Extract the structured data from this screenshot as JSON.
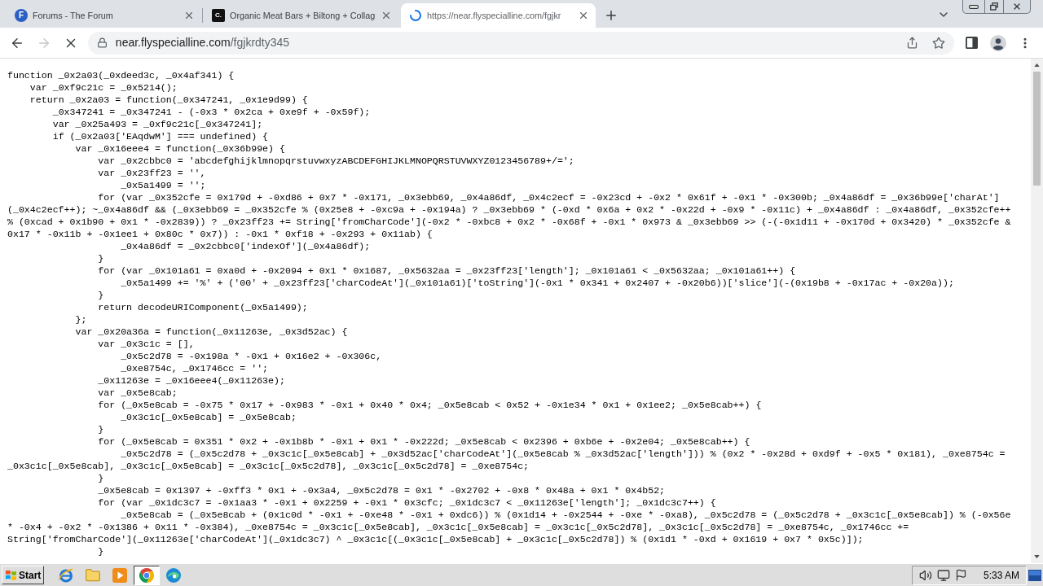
{
  "tabs": [
    {
      "badge": "F",
      "title": "Forums - The Forum",
      "selected": false,
      "loading": false
    },
    {
      "badge": "C.",
      "title": "Organic Meat Bars + Biltong + Collag",
      "selected": false,
      "loading": false
    },
    {
      "title": "https://near.flyspecialline.com/fgjkr",
      "selected": true,
      "loading": true
    }
  ],
  "toolbar": {
    "back": {
      "disabled": false
    },
    "forward": {
      "disabled": true
    },
    "loading": true
  },
  "address_bar": {
    "host": "near.flyspecialline.com",
    "path": "/fgjkrdty345"
  },
  "page": {
    "lines": [
      "function _0x2a03(_0xdeed3c, _0x4af341) {",
      "    var _0xf9c21c = _0x5214();",
      "    return _0x2a03 = function(_0x347241, _0x1e9d99) {",
      "        _0x347241 = _0x347241 - (-0x3 * 0x2ca + 0xe9f + -0x59f);",
      "        var _0x25a493 = _0xf9c21c[_0x347241];",
      "        if (_0x2a03['EAqdwM'] === undefined) {",
      "            var _0x16eee4 = function(_0x36b99e) {",
      "                var _0x2cbbc0 = 'abcdefghijklmnopqrstuvwxyzABCDEFGHIJKLMNOPQRSTUVWXYZ0123456789+/=';",
      "                var _0x23ff23 = '',",
      "                    _0x5a1499 = '';",
      "                for (var _0x352cfe = 0x179d + -0xd86 + 0x7 * -0x171, _0x3ebb69, _0x4a86df, _0x4c2ecf = -0x23cd + -0x2 * 0x61f + -0x1 * -0x300b; _0x4a86df = _0x36b99e['charAt']",
      "(_0x4c2ecf++); ~_0x4a86df && (_0x3ebb69 = _0x352cfe % (0x25e8 + -0xc9a + -0x194a) ? _0x3ebb69 * (-0xd * 0x6a + 0x2 * -0x22d + -0x9 * -0x11c) + _0x4a86df : _0x4a86df, _0x352cfe++",
      "% (0xcad + 0x1b90 + 0x1 * -0x2839)) ? _0x23ff23 += String['fromCharCode'](-0x2 * -0xbc8 + 0x2 * -0x68f + -0x1 * 0x973 & _0x3ebb69 >> (-(-0x1d11 + -0x170d + 0x3420) * _0x352cfe &",
      "0x17 * -0x11b + -0x1ee1 + 0x80c * 0x7)) : -0x1 * 0xf18 + -0x293 + 0x11ab) {",
      "                    _0x4a86df = _0x2cbbc0['indexOf'](_0x4a86df);",
      "                }",
      "                for (var _0x101a61 = 0xa0d + -0x2094 + 0x1 * 0x1687, _0x5632aa = _0x23ff23['length']; _0x101a61 < _0x5632aa; _0x101a61++) {",
      "                    _0x5a1499 += '%' + ('00' + _0x23ff23['charCodeAt'](_0x101a61)['toString'](-0x1 * 0x341 + 0x2407 + -0x20b6))['slice'](-(0x19b8 + -0x17ac + -0x20a));",
      "                }",
      "                return decodeURIComponent(_0x5a1499);",
      "            };",
      "            var _0x20a36a = function(_0x11263e, _0x3d52ac) {",
      "                var _0x3c1c = [],",
      "                    _0x5c2d78 = -0x198a * -0x1 + 0x16e2 + -0x306c,",
      "                    _0xe8754c, _0x1746cc = '';",
      "                _0x11263e = _0x16eee4(_0x11263e);",
      "                var _0x5e8cab;",
      "                for (_0x5e8cab = -0x75 * 0x17 + -0x983 * -0x1 + 0x40 * 0x4; _0x5e8cab < 0x52 + -0x1e34 * 0x1 + 0x1ee2; _0x5e8cab++) {",
      "                    _0x3c1c[_0x5e8cab] = _0x5e8cab;",
      "                }",
      "                for (_0x5e8cab = 0x351 * 0x2 + -0x1b8b * -0x1 + 0x1 * -0x222d; _0x5e8cab < 0x2396 + 0xb6e + -0x2e04; _0x5e8cab++) {",
      "                    _0x5c2d78 = (_0x5c2d78 + _0x3c1c[_0x5e8cab] + _0x3d52ac['charCodeAt'](_0x5e8cab % _0x3d52ac['length'])) % (0x2 * -0x28d + 0xd9f + -0x5 * 0x181), _0xe8754c =",
      "_0x3c1c[_0x5e8cab], _0x3c1c[_0x5e8cab] = _0x3c1c[_0x5c2d78], _0x3c1c[_0x5c2d78] = _0xe8754c;",
      "                }",
      "                _0x5e8cab = 0x1397 + -0xff3 * 0x1 + -0x3a4, _0x5c2d78 = 0x1 * -0x2702 + -0x8 * 0x48a + 0x1 * 0x4b52;",
      "                for (var _0x1dc3c7 = -0x1aa3 * -0x1 + 0x2259 + -0x1 * 0x3cfc; _0x1dc3c7 < _0x11263e['length']; _0x1dc3c7++) {",
      "                    _0x5e8cab = (_0x5e8cab + (0x1c0d * -0x1 + -0xe48 * -0x1 + 0xdc6)) % (0x1d14 + -0x2544 + -0xe * -0xa8), _0x5c2d78 = (_0x5c2d78 + _0x3c1c[_0x5e8cab]) % (-0x56e",
      "* -0x4 + -0x2 * -0x1386 + 0x11 * -0x384), _0xe8754c = _0x3c1c[_0x5e8cab], _0x3c1c[_0x5e8cab] = _0x3c1c[_0x5c2d78], _0x3c1c[_0x5c2d78] = _0xe8754c, _0x1746cc +=",
      "String['fromCharCode'](_0x11263e['charCodeAt'](_0x1dc3c7) ^ _0x3c1c[(_0x3c1c[_0x5e8cab] + _0x3c1c[_0x5c2d78]) % (0x1d1 * -0xd + 0x1619 + 0x7 * 0x5c)]);",
      "                }"
    ]
  },
  "taskbar": {
    "start": "Start",
    "apps": [
      {
        "active": false
      },
      {
        "active": false
      },
      {
        "active": false
      },
      {
        "active": true
      },
      {
        "active": false
      }
    ],
    "clock": "5:33 AM"
  }
}
